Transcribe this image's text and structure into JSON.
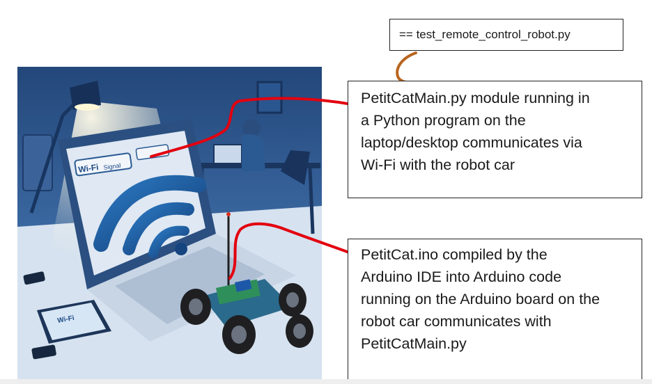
{
  "file_label": "== test_remote_control_robot.py",
  "python_description": "PetitCatMain.py module running in\na Python program on the\nlaptop/desktop communicates via\nWi-Fi with the robot car",
  "arduino_description": "PetitCat.ino compiled by the\nArduino IDE into Arduino code\nrunning on the Arduino board on the\nrobot car communicates with\nPetitCatMain.py",
  "illustration": {
    "laptop_sign": "Wi-Fi",
    "laptop_sign_extra": "Signal",
    "phone_screen": "Wi-Fi"
  },
  "colors": {
    "connector_red": "#e3000f",
    "connector_brown": "#b8651e",
    "scene_blue": "#2c5a8f"
  }
}
